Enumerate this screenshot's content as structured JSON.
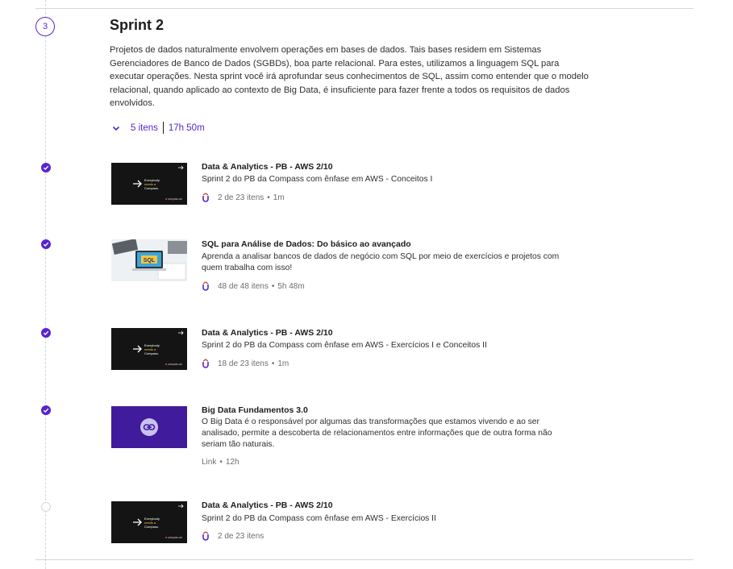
{
  "section": {
    "number": "3",
    "title": "Sprint 2",
    "description": "Projetos de dados naturalmente envolvem operações em bases de dados. Tais bases residem em Sistemas Gerenciadores de Banco de Dados (SGBDs), boa parte relacional. Para estes, utilizamos a linguagem SQL para executar operações. Nesta sprint você irá aprofundar seus conhecimentos de SQL, assim como entender que o modelo relacional, quando aplicado ao contexto de Big Data, é insuficiente para fazer frente a todos os requisitos de dados envolvidos.",
    "items_count": "5 itens",
    "duration": "17h 50m"
  },
  "thumb_text": {
    "dark_tagline_1": "Everybody",
    "dark_tagline_2": "needs a",
    "dark_tagline_3": "Compass.",
    "dark_brand": "compass.uol",
    "sql_badge": "SQL"
  },
  "items": [
    {
      "title": "Data & Analytics - PB - AWS 2/10",
      "subtitle": "Sprint 2 do PB da Compass com ênfase em AWS - Conceitos I",
      "progress": "2 de 23 itens",
      "duration": "1m",
      "completed": true
    },
    {
      "title": "SQL para Análise de Dados: Do básico ao avançado",
      "subtitle": "Aprenda a analisar bancos de dados de negócio com SQL por meio de exercícios e projetos com quem trabalha com isso!",
      "progress": "48 de 48 itens",
      "duration": "5h 48m",
      "completed": true
    },
    {
      "title": "Data & Analytics - PB - AWS 2/10",
      "subtitle": "Sprint 2 do PB da Compass com ênfase em AWS - Exercícios I e Conceitos II",
      "progress": "18 de 23 itens",
      "duration": "1m",
      "completed": true
    },
    {
      "title": "Big Data Fundamentos 3.0",
      "subtitle": "O Big Data é o responsável por algumas das transformações que estamos vivendo e ao ser analisado, permite a descoberta de relacionamentos entre informações que de outra forma não seriam tão naturais.",
      "type": "Link",
      "duration": "12h",
      "completed": true
    },
    {
      "title": "Data & Analytics - PB - AWS 2/10",
      "subtitle": "Sprint 2 do PB da Compass com ênfase em AWS - Exercícios II",
      "progress": "2 de 23 itens",
      "completed": false
    }
  ],
  "meta_separator": "•",
  "colors": {
    "accent": "#5624d0",
    "divider": "#d1d7dc",
    "text": "#1c1d1f",
    "muted": "#6a6f73",
    "thumb_dark": "#141414",
    "thumb_purple": "#401b9c",
    "tagline_yellow": "#f3c623"
  },
  "icons": [
    "check-icon",
    "chevron-down-icon",
    "udemy-business-icon",
    "link-icon",
    "arrow-right-icon"
  ]
}
